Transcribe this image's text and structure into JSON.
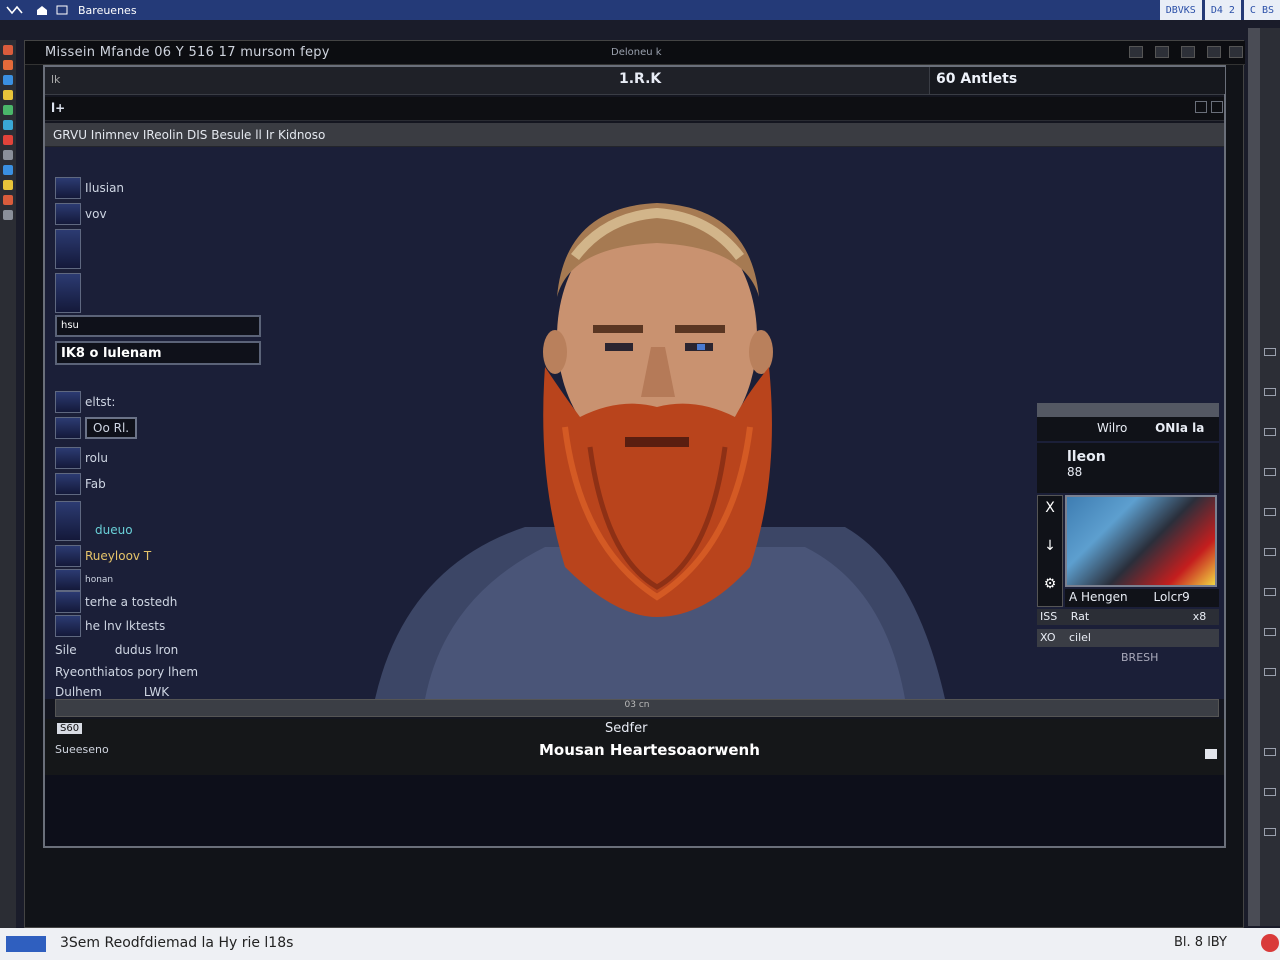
{
  "topbar": {
    "app_name": "Bareuenes",
    "pills": [
      "DBVKS",
      "D4 2",
      "C BS"
    ]
  },
  "window": {
    "title": "Missein Mfande 06 Y 516 17 mursom fepy",
    "center_label": "Deloneu k",
    "tabs": {
      "left": "lk",
      "center": "1.R.K",
      "right": "60 Antlets"
    },
    "toolbar_label": "l+",
    "path": "GRVU Inimnev IReolin DIS Besule ll Ir Kidnoso"
  },
  "left_list": {
    "top_items": [
      "Ilusian",
      "vov"
    ],
    "box1": "hsu",
    "box2": "IK8 o  lulenam",
    "items": [
      {
        "id": "i1",
        "label": "eltst:"
      },
      {
        "id": "i2",
        "label": "Oo Rl."
      },
      {
        "id": "i3",
        "label": "rolu"
      },
      {
        "id": "i4",
        "label": "Fab"
      },
      {
        "id": "i5",
        "label": "dueuo"
      },
      {
        "id": "i6",
        "label": "Rueyloov  T"
      },
      {
        "id": "i7",
        "label": "honan"
      },
      {
        "id": "i8",
        "label": "terhe a tostedh"
      },
      {
        "id": "i9",
        "label": "he lnv lktests"
      },
      {
        "id": "i10",
        "label": "Sile          dudus lron"
      },
      {
        "id": "i11",
        "label": "Ryeonthiatos pory lhem"
      },
      {
        "id": "i12",
        "label": "Dulhem           LWK"
      }
    ]
  },
  "right_panel": {
    "row1_left": "Wilro",
    "row1_right": "ONIa la",
    "title": "lleon",
    "sub": "88",
    "icons": [
      "X",
      "↓",
      "⚙"
    ],
    "caption_left": "A Hengen",
    "caption_right": "Lolcr9",
    "row_a_left": "ISS",
    "row_a_mid": "Rat",
    "row_a_right": "x8",
    "row_b_left": "XO",
    "row_b_mid": "cilel",
    "below": "BRESH"
  },
  "scrub_label": "03 cn",
  "info": {
    "badge": "S60",
    "sub": "Sueeseno",
    "caption1": "Sedfer",
    "caption2": "Mousan Heartesoaorwenh"
  },
  "status": {
    "text": "3Sem Reodfdiemad la Hy rie l18s",
    "right": "Bl.  8  lBY"
  },
  "colors": {
    "accent": "#243a78",
    "beard": "#b9441c",
    "viewport_bg": "#1b1f38"
  }
}
